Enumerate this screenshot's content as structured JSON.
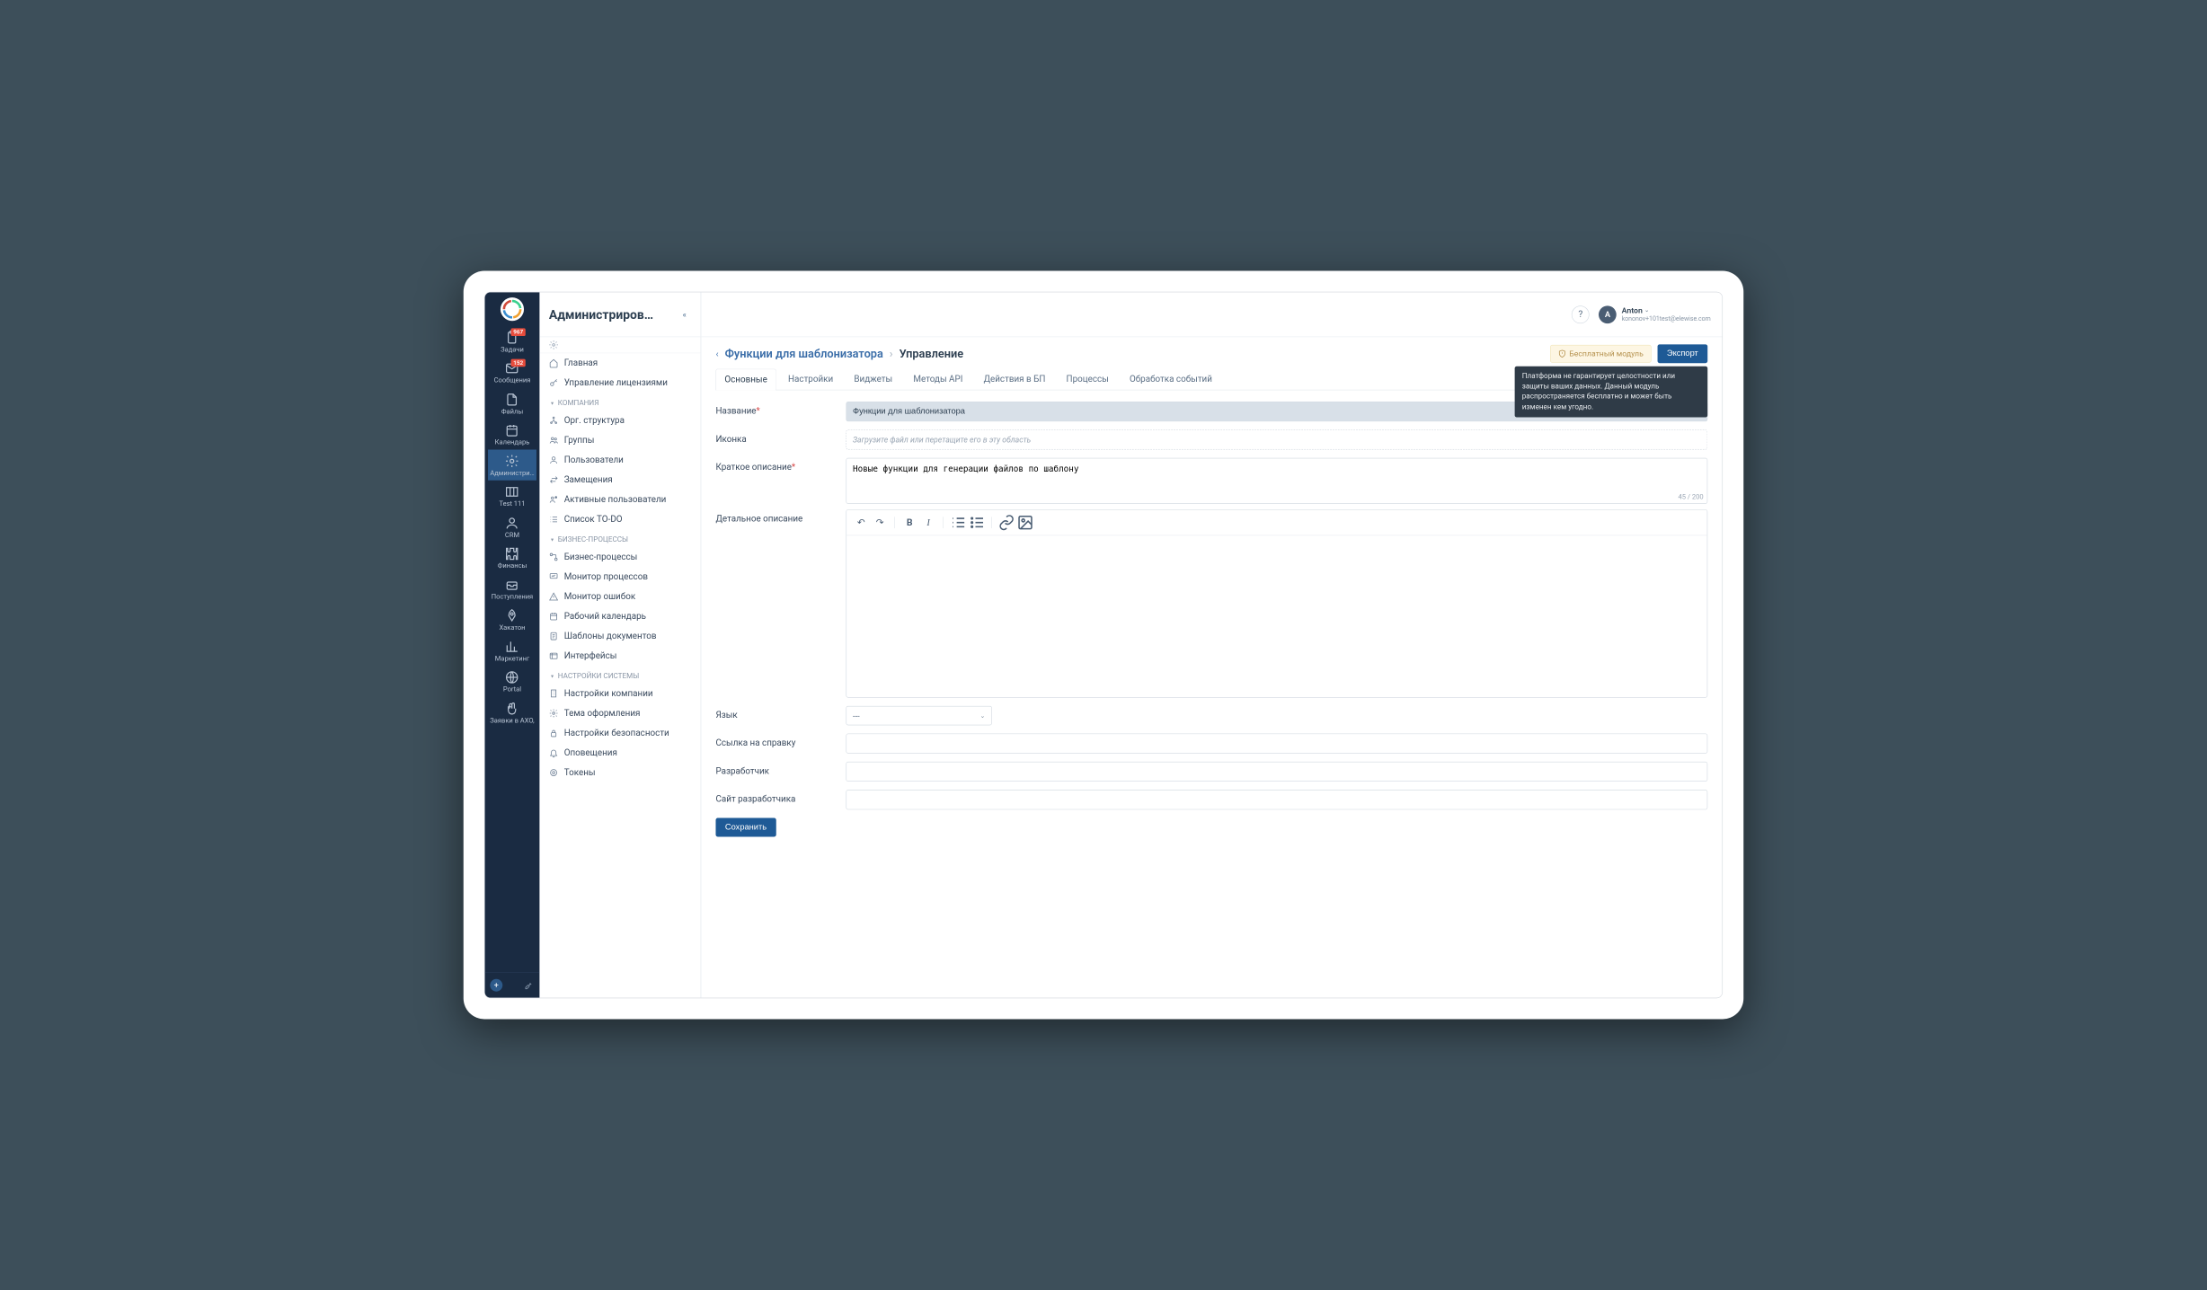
{
  "header": {
    "sidebar_title": "Администриров…"
  },
  "user": {
    "initial": "A",
    "name": "Anton",
    "email": "kononov+101test@elewise.com"
  },
  "nav": [
    {
      "label": "Задачи",
      "badge": "967",
      "icon": "clipboard"
    },
    {
      "label": "Сообщения",
      "badge": "152",
      "icon": "envelope"
    },
    {
      "label": "Файлы",
      "icon": "file"
    },
    {
      "label": "Календарь",
      "icon": "calendar"
    },
    {
      "label": "Администри…",
      "icon": "gear",
      "active": true
    },
    {
      "label": "Test 111",
      "icon": "columns"
    },
    {
      "label": "CRM",
      "icon": "person"
    },
    {
      "label": "Финансы",
      "icon": "puzzle"
    },
    {
      "label": "Поступления",
      "icon": "inbox"
    },
    {
      "label": "Хакатон",
      "icon": "rocket"
    },
    {
      "label": "Маркетинг",
      "icon": "chart"
    },
    {
      "label": "Portal",
      "icon": "globe"
    },
    {
      "label": "Заявки в АХО,",
      "icon": "hands"
    }
  ],
  "sidebar": {
    "links_top": [
      {
        "label": "Главная",
        "icon": "home"
      },
      {
        "label": "Управление лицензиями",
        "icon": "key"
      }
    ],
    "section_company": "КОМПАНИЯ",
    "company_links": [
      {
        "label": "Орг. структура",
        "icon": "org"
      },
      {
        "label": "Группы",
        "icon": "group"
      },
      {
        "label": "Пользователи",
        "icon": "user"
      },
      {
        "label": "Замещения",
        "icon": "swap"
      },
      {
        "label": "Активные пользователи",
        "icon": "active"
      },
      {
        "label": "Список TO-DO",
        "icon": "list"
      }
    ],
    "section_bp": "БИЗНЕС-ПРОЦЕССЫ",
    "bp_links": [
      {
        "label": "Бизнес-процессы",
        "icon": "bp"
      },
      {
        "label": "Монитор процессов",
        "icon": "monitor"
      },
      {
        "label": "Монитор ошибок",
        "icon": "alert"
      },
      {
        "label": "Рабочий календарь",
        "icon": "cal"
      },
      {
        "label": "Шаблоны документов",
        "icon": "tpl"
      },
      {
        "label": "Интерфейсы",
        "icon": "ui"
      }
    ],
    "section_sys": "НАСТРОЙКИ СИСТЕМЫ",
    "sys_links": [
      {
        "label": "Настройки компании",
        "icon": "building"
      },
      {
        "label": "Тема оформления",
        "icon": "theme"
      },
      {
        "label": "Настройки безопасности",
        "icon": "lock"
      },
      {
        "label": "Оповещения",
        "icon": "bell"
      },
      {
        "label": "Токены",
        "icon": "token"
      }
    ]
  },
  "breadcrumb": {
    "link": "Функции для шаблонизатора",
    "current": "Управление"
  },
  "actions": {
    "free_badge": "Бесплатный модуль",
    "export": "Экспорт"
  },
  "tooltip": "Платформа не гарантирует целостности или защиты ваших данных. Данный модуль распространяется бесплатно и может быть изменен кем угодно.",
  "tabs": [
    "Основные",
    "Настройки",
    "Виджеты",
    "Методы API",
    "Действия в БП",
    "Процессы",
    "Обработка событий"
  ],
  "form": {
    "name_label": "Название",
    "name_value": "Функции для шаблонизатора",
    "icon_label": "Иконка",
    "icon_placeholder": "Загрузите файл или перетащите его в эту область",
    "short_label": "Краткое описание",
    "short_value": "Новые функции для генерации файлов по шаблону",
    "short_counter": "45 / 200",
    "detail_label": "Детальное описание",
    "lang_label": "Язык",
    "lang_value": "---",
    "helplink_label": "Ссылка на справку",
    "dev_label": "Разработчик",
    "devsite_label": "Сайт разработчика",
    "save": "Сохранить"
  }
}
